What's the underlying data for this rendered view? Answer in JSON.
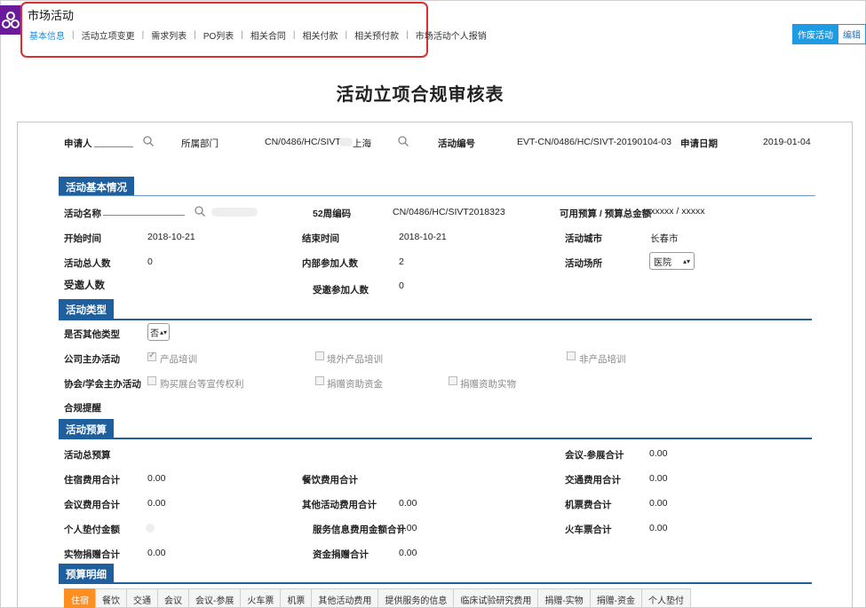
{
  "app": {
    "title": "市场活动"
  },
  "tabs": [
    {
      "label": "基本信息"
    },
    {
      "label": "活动立项变更"
    },
    {
      "label": "需求列表"
    },
    {
      "label": "PO列表"
    },
    {
      "label": "相关合同"
    },
    {
      "label": "相关付款"
    },
    {
      "label": "相关预付款"
    },
    {
      "label": "市场活动个人报销"
    }
  ],
  "actions": {
    "void_label": "作废活动",
    "edit_label": "编辑"
  },
  "page": {
    "title": "活动立项合规审核表"
  },
  "header_fields": {
    "applicant_label": "申请人",
    "dept_label": "所属部门",
    "dept_value": "CN/0486/HC/SIVT",
    "city_value": "上海",
    "activity_no_label": "活动编号",
    "activity_no_value": "EVT-CN/0486/HC/SIVT-20190104-03",
    "apply_date_label": "申请日期",
    "apply_date_value": "2019-01-04"
  },
  "basic": {
    "section_title": "活动基本情况",
    "name_label": "活动名称",
    "week_code_label": "52周编码",
    "week_code_value": "CN/0486/HC/SIVT2018323",
    "budget_label": "可用预算 / 预算总金额",
    "budget_value": "xxxxxx / xxxxx",
    "start_label": "开始时间",
    "start_value": "2018-10-21",
    "end_label": "结束时间",
    "end_value": "2018-10-21",
    "city_label": "活动城市",
    "city_value": "长春市",
    "total_people_label": "活动总人数",
    "total_people_value": "0",
    "internal_label": "内部参加人数",
    "internal_value": "2",
    "venue_label": "活动场所",
    "venue_value": "医院",
    "invited_label": "受邀人数",
    "invited_attend_label": "受邀参加人数",
    "invited_attend_value": "0"
  },
  "type": {
    "section_title": "活动类型",
    "other_type_label": "是否其他类型",
    "other_type_value": "否",
    "company_label": "公司主办活动",
    "opt_product_training": "产品培训",
    "opt_overseas_training": "境外产品培训",
    "opt_non_product_training": "非产品培训",
    "assoc_label": "协会/学会主办活动",
    "opt_booth": "购买展台等宣传权利",
    "opt_donate_fund": "捐赠资助资金",
    "opt_donate_goods": "捐赠资助实物",
    "compliance_label": "合规提醒"
  },
  "budget": {
    "section_title": "活动预算",
    "total_label": "活动总预算",
    "meeting_exhibit_label": "会议-参展合计",
    "meeting_exhibit_value": "0.00",
    "lodging_label": "住宿费用合计",
    "lodging_value": "0.00",
    "catering_label": "餐饮费用合计",
    "transport_label": "交通费用合计",
    "transport_value": "0.00",
    "meeting_label": "会议费用合计",
    "meeting_value": "0.00",
    "other_label": "其他活动费用合计",
    "other_value": "0.00",
    "air_label": "机票费合计",
    "air_value": "0.00",
    "personal_label": "个人垫付金额",
    "service_label": "服务信息费用金额合计",
    "service_value": "0.00",
    "train_label": "火车票合计",
    "train_value": "0.00",
    "goods_donation_label": "实物捐赠合计",
    "goods_donation_value": "0.00",
    "fund_donation_label": "资金捐赠合计",
    "fund_donation_value": "0.00"
  },
  "detail": {
    "section_title": "预算明细",
    "tabs": [
      {
        "label": "住宿"
      },
      {
        "label": "餐饮"
      },
      {
        "label": "交通"
      },
      {
        "label": "会议"
      },
      {
        "label": "会议-参展"
      },
      {
        "label": "火车票"
      },
      {
        "label": "机票"
      },
      {
        "label": "其他活动费用"
      },
      {
        "label": "提供服务的信息"
      },
      {
        "label": "临床试验研究费用"
      },
      {
        "label": "捐赠-实物"
      },
      {
        "label": "捐赠-资金"
      },
      {
        "label": "个人垫付"
      }
    ]
  }
}
